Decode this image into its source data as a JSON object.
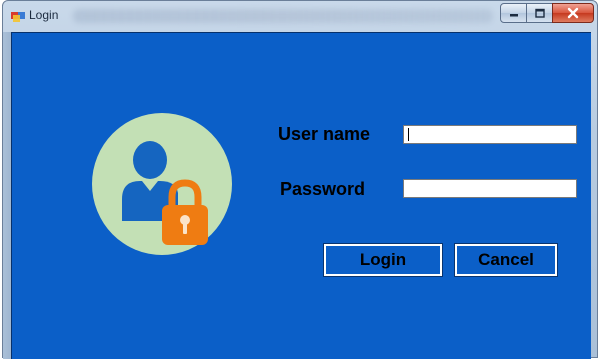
{
  "window": {
    "title": "Login",
    "controls": {
      "minimize_icon": "minimize-icon",
      "maximize_icon": "maximize-icon",
      "close_icon": "close-icon"
    }
  },
  "form": {
    "username_label": "User name",
    "username_value": "",
    "password_label": "Password",
    "password_value": "",
    "login_button": "Login",
    "cancel_button": "Cancel"
  },
  "avatar": {
    "icon": "user-lock-icon",
    "circle_color": "#c3e0b5",
    "person_color": "#1565c0",
    "lock_color": "#ef7c12"
  },
  "colors": {
    "client_background": "#0b5fc8",
    "label_text": "#000000",
    "button_border": "#ffffff"
  }
}
